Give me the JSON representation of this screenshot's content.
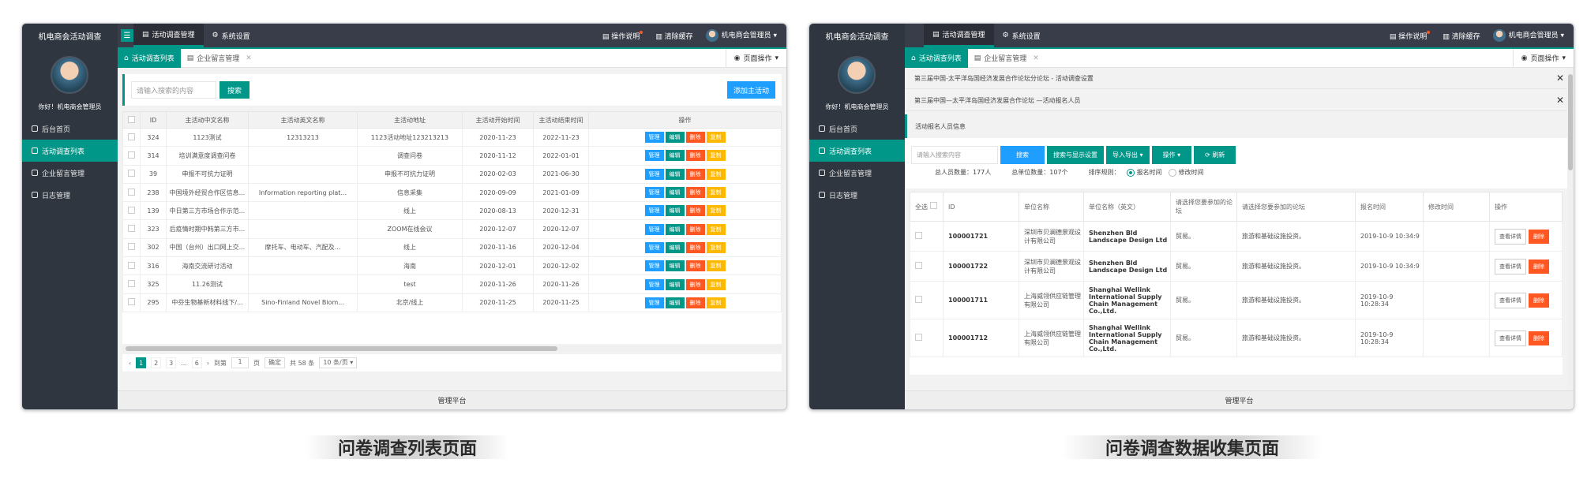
{
  "panel1": {
    "sidebar": {
      "app_title": "机电商会活动调查",
      "greeting": "你好！机电商会管理员",
      "menu": [
        "后台首页",
        "活动调查列表",
        "企业留言管理",
        "日志管理"
      ]
    },
    "topbar": {
      "toggle_icon": "☰",
      "tabs": [
        "活动调查管理",
        "系统设置"
      ],
      "help": "操作说明",
      "clear_cache": "清除缓存",
      "user": "机电商会管理员"
    },
    "tabbar": {
      "tabs": [
        "活动调查列表",
        "企业留言管理"
      ],
      "page_ops": "页面操作"
    },
    "search": {
      "placeholder": "请输入搜索的内容",
      "search_btn": "搜索",
      "add_btn": "添加主活动"
    },
    "table": {
      "headers": [
        "ID",
        "主活动中文名称",
        "主活动英文名称",
        "主活动地址",
        "主活动开始时间",
        "主活动结束时间",
        "操作"
      ],
      "actions": [
        "管理",
        "编辑",
        "删除",
        "复制"
      ],
      "rows": [
        [
          "324",
          "1123测试",
          "12313213",
          "1123活动地址123213213",
          "2020-11-23",
          "2022-11-23"
        ],
        [
          "314",
          "培训满意度调查问卷",
          "",
          "调查问卷",
          "2020-11-12",
          "2022-01-01"
        ],
        [
          "39",
          "申报不可抗力证明",
          "",
          "申报不可抗力证明",
          "2020-02-03",
          "2021-06-30"
        ],
        [
          "238",
          "中国境外经贸合作区信息...",
          "Information reporting plat...",
          "信息采集",
          "2020-09-09",
          "2021-01-09"
        ],
        [
          "139",
          "中日第三方市场合作示范...",
          "",
          "线上",
          "2020-08-13",
          "2020-12-31"
        ],
        [
          "323",
          "后疫情时期中韩第三方市...",
          "",
          "ZOOM在线会议",
          "2020-12-07",
          "2020-12-07"
        ],
        [
          "302",
          "中国（台州）出口网上交...",
          "摩托车、电动车、汽配及...",
          "线上",
          "2020-11-16",
          "2020-12-04"
        ],
        [
          "316",
          "海南交流研讨活动",
          "",
          "海南",
          "2020-12-01",
          "2020-12-02"
        ],
        [
          "325",
          "11.26测试",
          "",
          "test",
          "2020-11-26",
          "2020-11-26"
        ],
        [
          "295",
          "中芬生物基新材料线下/...",
          "Sino-Finland Novel Biom...",
          "北京/线上",
          "2020-11-25",
          "2020-11-25"
        ]
      ]
    },
    "pager": {
      "prev": "‹",
      "pages": [
        "1",
        "2",
        "3",
        "...",
        "6"
      ],
      "next": "›",
      "goto_label": "到第",
      "goto_value": "1",
      "page_unit": "页",
      "confirm": "确定",
      "total": "共 58 条",
      "per_page": "10 条/页 ▾"
    },
    "footer": "管理平台"
  },
  "panel2": {
    "sidebar": {
      "app_title": "机电商会活动调查",
      "greeting": "你好！机电商会管理员",
      "menu": [
        "后台首页",
        "活动调查列表",
        "企业留言管理",
        "日志管理"
      ]
    },
    "topbar": {
      "toggle_icon": "☰",
      "tabs": [
        "活动调查管理",
        "系统设置"
      ],
      "help": "操作说明",
      "clear_cache": "清除缓存",
      "user": "机电商会管理员"
    },
    "tabbar": {
      "tabs": [
        "活动调查列表",
        "企业留言管理"
      ],
      "page_ops": "页面操作"
    },
    "notices": [
      "第三届中国-太平洋岛国经济发展合作论坛分论坛 - 活动调查设置",
      "第三届中国—太平洋岛国经济发展合作论坛 —活动报名人员"
    ],
    "section_title": "活动报名人员信息",
    "toolbar": {
      "placeholder": "请输入搜索内容",
      "search": "搜索",
      "search_display": "搜索与显示设置",
      "import_export": "导入导出 ▾",
      "operation": "操作 ▾",
      "refresh": "⟳ 刷新"
    },
    "stats": {
      "total_people": "总人员数量：177人",
      "total_units": "总单位数量：107个",
      "sort_label": "排序规则：",
      "sort_opt1": "报名时间",
      "sort_opt2": "修改时间"
    },
    "table": {
      "headers": [
        "全选",
        "ID",
        "单位名称",
        "单位名称（英文）",
        "请选择您要参加的论坛",
        "请选择您要参加的论坛",
        "报名时间",
        "修改时间",
        "操作"
      ],
      "view_btn": "查看详情",
      "delete_btn": "删除",
      "rows": [
        [
          "100001721",
          "深圳市贝澜德景观设计有限公司",
          "Shenzhen Bld Landscape Design Ltd",
          "贸易。",
          "旅游和基础设施投资。",
          "2019-10-9 10:34:9",
          ""
        ],
        [
          "100001722",
          "深圳市贝澜德景观设计有限公司",
          "Shenzhen Bld Landscape Design Ltd",
          "贸易。",
          "旅游和基础设施投资。",
          "2019-10-9 10:34:9",
          ""
        ],
        [
          "100001711",
          "上海威翎供应链管理有限公司",
          "Shanghai Wellink International Supply Chain Management Co.,Ltd.",
          "贸易。",
          "旅游和基础设施投资。",
          "2019-10-9 10:28:34",
          ""
        ],
        [
          "100001712",
          "上海威翎供应链管理有限公司",
          "Shanghai Wellink International Supply Chain Management Co.,Ltd.",
          "贸易。",
          "旅游和基础设施投资。",
          "2019-10-9 10:28:34",
          ""
        ]
      ]
    },
    "footer": "管理平台"
  },
  "captions": [
    "问卷调查列表页面",
    "问卷调查数据收集页面"
  ],
  "colors": {
    "teal": "#009688",
    "blue": "#1e9fff",
    "red": "#ff5722",
    "yellow": "#ffb800",
    "dark": "#393d49"
  }
}
